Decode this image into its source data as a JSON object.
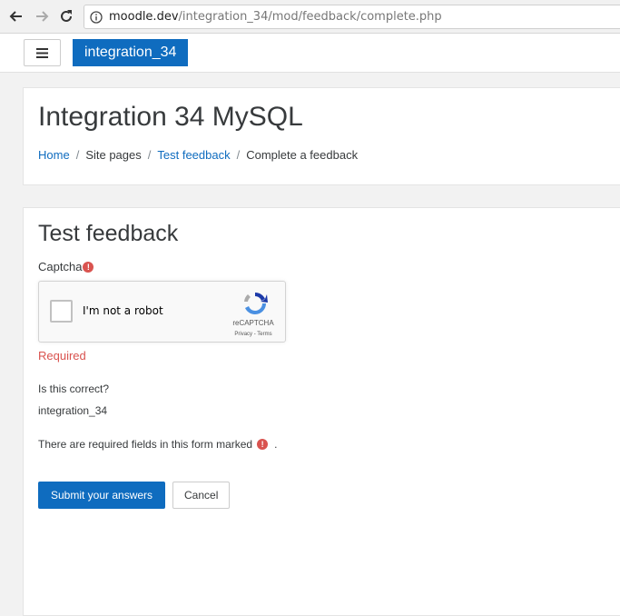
{
  "browser": {
    "url_host": "moodle.dev",
    "url_path": "/integration_34/mod/feedback/complete.php",
    "back_icon": "arrow-left-icon",
    "forward_icon": "arrow-right-icon",
    "reload_icon": "reload-icon",
    "info_icon": "info-icon"
  },
  "navbar": {
    "brand": "integration_34",
    "menu_icon": "hamburger-icon"
  },
  "header": {
    "site_title": "Integration 34 MySQL",
    "breadcrumb": {
      "home": "Home",
      "site_pages": "Site pages",
      "test_feedback": "Test feedback",
      "current": "Complete a feedback",
      "separator": "/"
    }
  },
  "main": {
    "title": "Test feedback",
    "captcha": {
      "label": "Captcha",
      "required_icon": "!",
      "checkbox_label": "I'm not a robot",
      "brand": "reCAPTCHA",
      "terms": "Privacy - Terms",
      "error": "Required"
    },
    "question": "Is this correct?",
    "answer": "integration_34",
    "required_note": "There are required fields in this form marked",
    "required_note_icon": "!",
    "required_note_end": ".",
    "buttons": {
      "submit": "Submit your answers",
      "cancel": "Cancel"
    }
  },
  "colors": {
    "primary": "#0f6cbf",
    "danger": "#d9534f"
  }
}
